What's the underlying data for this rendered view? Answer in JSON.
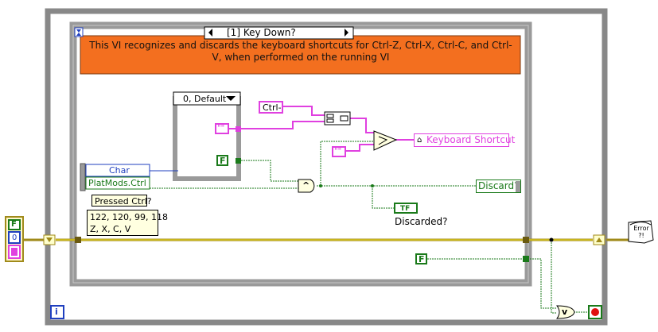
{
  "event_case": {
    "selector": "[1] Key Down?",
    "comment": "This VI recognizes and discards the keyboard shortcuts for Ctrl-Z, Ctrl-X, Ctrl-C, and Ctrl-V, when performed on the running VI"
  },
  "inner_case": {
    "selector": "0, Default"
  },
  "event_data": {
    "char": "Char",
    "platmods": "PlatMods.Ctrl"
  },
  "labels": {
    "pressed_ctrl": "Pressed Ctrl?",
    "ctrl_const": "Ctrl-",
    "empty_string": "\"\"",
    "false_const": "F",
    "keyboard_shortcut": "Keyboard Shortcut",
    "discard": "Discard?",
    "discarded": "Discarded?",
    "tf": "TF",
    "and_gate": "^",
    "or_gate": "v",
    "error_icon": "Error ?!",
    "iteration": "i",
    "numeric_zero": "0",
    "false_left": "F"
  },
  "note": {
    "line1": "122, 120, 99, 118",
    "line2": "Z, X, C, V"
  },
  "colors": {
    "frame": "#808080",
    "orange": "#f36f1f",
    "string_wire": "#e040e0",
    "bool_wire": "#1a7a1a",
    "error_wire": "#a08a1a",
    "numeric_blue": "#1f3fbf"
  }
}
